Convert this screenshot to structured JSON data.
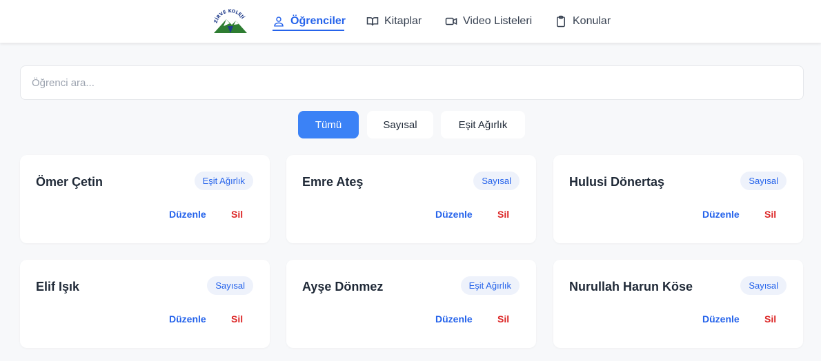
{
  "nav": {
    "logo_text": "ZİRVE KOLEJİ",
    "items": [
      {
        "label": "Öğrenciler",
        "icon": "user-icon",
        "active": true
      },
      {
        "label": "Kitaplar",
        "icon": "book-open-icon",
        "active": false
      },
      {
        "label": "Video Listeleri",
        "icon": "video-icon",
        "active": false
      },
      {
        "label": "Konular",
        "icon": "clipboard-icon",
        "active": false
      }
    ]
  },
  "search": {
    "placeholder": "Öğrenci ara...",
    "value": ""
  },
  "filters": [
    {
      "label": "Tümü",
      "selected": true
    },
    {
      "label": "Sayısal",
      "selected": false
    },
    {
      "label": "Eşit Ağırlık",
      "selected": false
    }
  ],
  "students": [
    {
      "name": "Ömer Çetin",
      "track": "Eşit Ağırlık",
      "edit_label": "Düzenle",
      "delete_label": "Sil"
    },
    {
      "name": "Emre Ateş",
      "track": "Sayısal",
      "edit_label": "Düzenle",
      "delete_label": "Sil"
    },
    {
      "name": "Hulusi Dönertaş",
      "track": "Sayısal",
      "edit_label": "Düzenle",
      "delete_label": "Sil"
    },
    {
      "name": "Elif Işık",
      "track": "Sayısal",
      "edit_label": "Düzenle",
      "delete_label": "Sil"
    },
    {
      "name": "Ayşe Dönmez",
      "track": "Eşit Ağırlık",
      "edit_label": "Düzenle",
      "delete_label": "Sil"
    },
    {
      "name": "Nurullah Harun Köse",
      "track": "Sayısal",
      "edit_label": "Düzenle",
      "delete_label": "Sil"
    }
  ],
  "colors": {
    "accent": "#2563eb",
    "primary_button": "#3b82f6",
    "danger": "#dc2626",
    "logo_green": "#2e7d32"
  }
}
